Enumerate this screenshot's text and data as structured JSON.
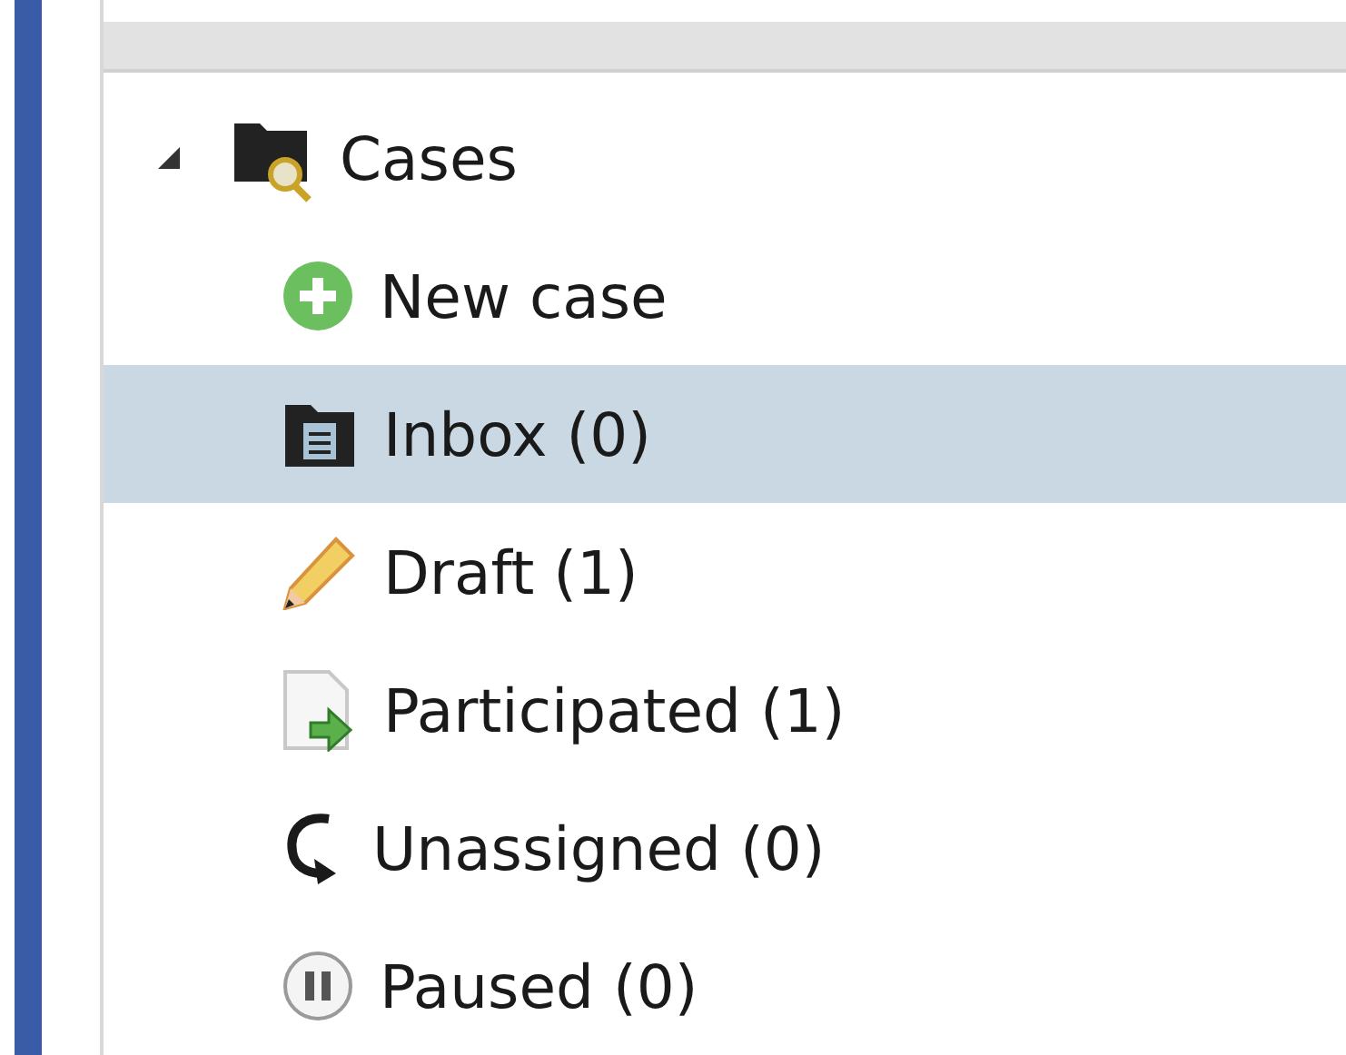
{
  "tree": {
    "label": "Cases",
    "expanded": true,
    "selected": false,
    "children": [
      {
        "label": "New case",
        "kind": "new",
        "selected": false
      },
      {
        "label": "Inbox (0)",
        "kind": "inbox",
        "selected": true
      },
      {
        "label": "Draft (1)",
        "kind": "draft",
        "selected": false
      },
      {
        "label": "Participated (1)",
        "kind": "participated",
        "selected": false
      },
      {
        "label": "Unassigned (0)",
        "kind": "unassigned",
        "selected": false
      },
      {
        "label": "Paused (0)",
        "kind": "paused",
        "selected": false
      }
    ]
  }
}
